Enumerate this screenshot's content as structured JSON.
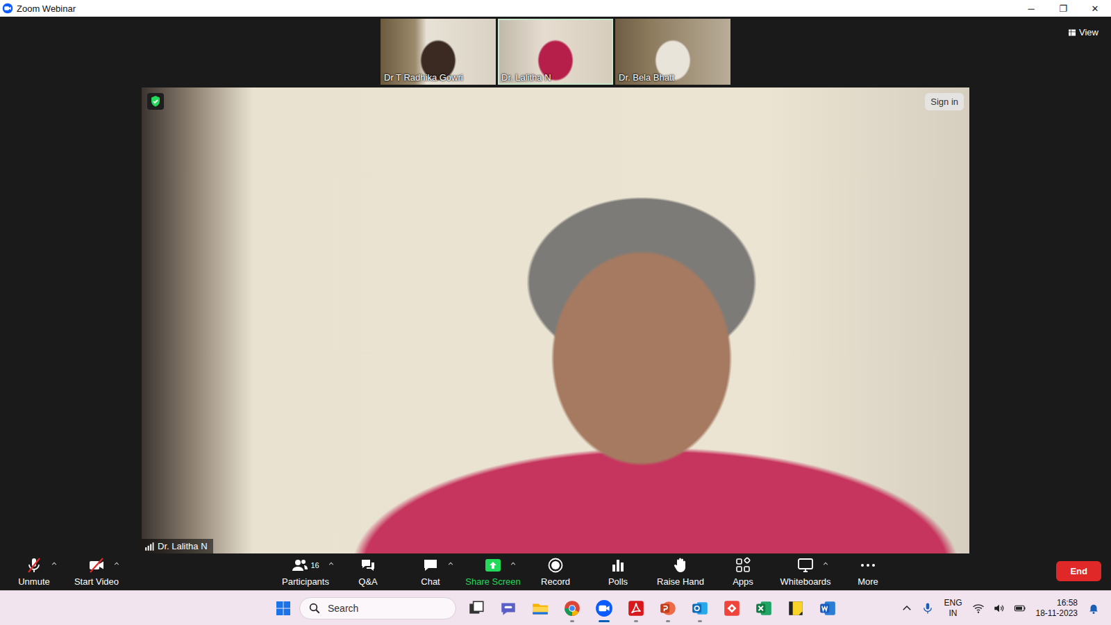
{
  "window": {
    "title": "Zoom Webinar",
    "controls": [
      "─",
      "❐",
      "✕"
    ]
  },
  "view_button": {
    "label": "View"
  },
  "gallery": [
    {
      "name": "Dr T Radhika Gowri",
      "active": false
    },
    {
      "name": "Dr. Lalitha N",
      "active": true
    },
    {
      "name": "Dr. Bela Bhatt",
      "active": false
    }
  ],
  "main_video": {
    "speaker": "Dr. Lalitha N",
    "sign_in": "Sign in",
    "secure": true
  },
  "toolbar": {
    "left": [
      {
        "label": "Unmute",
        "off": true,
        "has_menu": true
      },
      {
        "label": "Start Video",
        "off": true,
        "has_menu": true
      }
    ],
    "center": [
      {
        "label": "Participants",
        "count": "16",
        "has_menu": true,
        "highlighted": false
      },
      {
        "label": "Q&A",
        "has_menu": false,
        "highlighted": false
      },
      {
        "label": "Chat",
        "has_menu": true,
        "highlighted": false
      },
      {
        "label": "Share Screen",
        "has_menu": true,
        "highlighted": true
      },
      {
        "label": "Record",
        "has_menu": false,
        "highlighted": false
      },
      {
        "label": "Polls",
        "has_menu": false,
        "highlighted": false
      },
      {
        "label": "Raise Hand",
        "has_menu": false,
        "highlighted": false
      },
      {
        "label": "Apps",
        "has_menu": false,
        "highlighted": false
      },
      {
        "label": "Whiteboards",
        "has_menu": true,
        "highlighted": false
      },
      {
        "label": "More",
        "has_menu": false,
        "highlighted": false
      }
    ],
    "end": "End"
  },
  "taskbar": {
    "search": "Search",
    "apps": [
      {
        "running": false,
        "active": false
      },
      {
        "running": false,
        "active": false
      },
      {
        "running": false,
        "active": false
      },
      {
        "running": true,
        "active": false
      },
      {
        "running": true,
        "active": true
      },
      {
        "running": true,
        "active": false
      },
      {
        "running": true,
        "active": false
      },
      {
        "running": true,
        "active": false
      },
      {
        "running": false,
        "active": false
      },
      {
        "running": false,
        "active": false
      },
      {
        "running": false,
        "active": false
      },
      {
        "running": false,
        "active": false
      }
    ],
    "language": "ENG",
    "region": "IN",
    "time": "16:58",
    "date": "18-11-2023"
  }
}
